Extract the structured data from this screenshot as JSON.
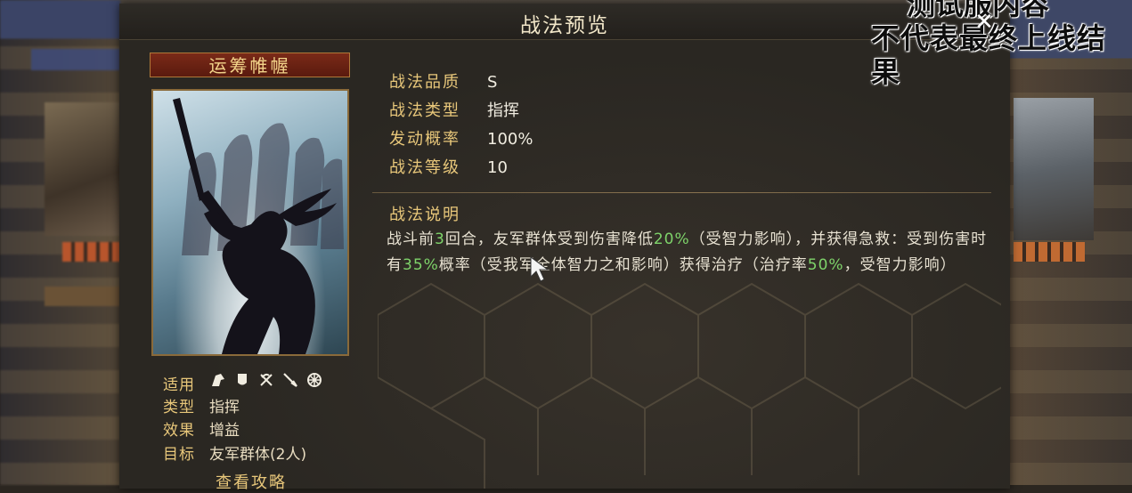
{
  "panel": {
    "title": "战法预览"
  },
  "watermark": {
    "line1": "测试服内容",
    "line2": "不代表最终上线结果"
  },
  "close": {
    "glyph": "✕"
  },
  "skill": {
    "name": "运筹帷幄",
    "quality_label": "战法品质",
    "quality": "S",
    "type_label": "战法类型",
    "type": "指挥",
    "rate_label": "发动概率",
    "rate": "100%",
    "level_label": "战法等级",
    "level": "10"
  },
  "meta": {
    "apply_label": "适用",
    "apply_icons": [
      "cavalry-icon",
      "shield-icon",
      "bow-icon",
      "spear-icon",
      "wheel-icon"
    ],
    "type_label": "类型",
    "type": "指挥",
    "effect_label": "效果",
    "effect": "增益",
    "target_label": "目标",
    "target": "友军群体(2人)",
    "guide_label": "查看攻略"
  },
  "description": {
    "title": "战法说明",
    "p1": "战斗前",
    "n1": "3",
    "p2": "回合，友军群体受到伤害降低",
    "n2": "20%",
    "p3": "（受智力影响），并获得急救：受到伤害时有",
    "n3": "35%",
    "p4": "概率（受我军全体智力之和影响）获得治疗（治疗率",
    "n4": "50%",
    "p5": "，受智力影响）"
  },
  "colors": {
    "accent": "#e8c77a",
    "highlight": "#7ed36a",
    "text": "#f0ece0"
  }
}
